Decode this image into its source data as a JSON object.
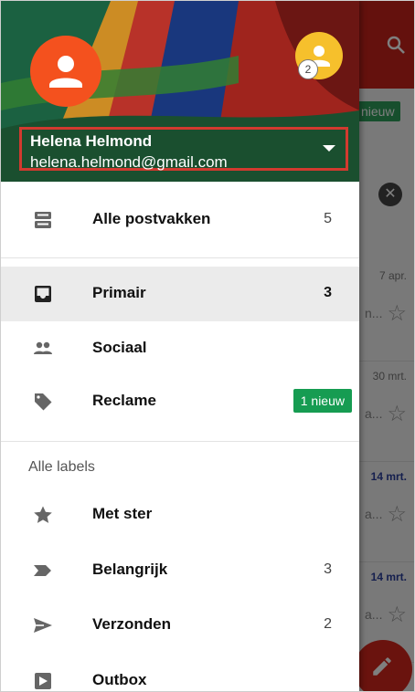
{
  "account": {
    "name": "Helena Helmond",
    "email": "helena.helmond@gmail.com",
    "secondary_badge": "2"
  },
  "background": {
    "chip": "nieuw",
    "dates": [
      "7 apr.",
      "30 mrt.",
      "14 mrt.",
      "14 mrt."
    ]
  },
  "drawer": {
    "all_inboxes": {
      "label": "Alle postvakken",
      "count": "5",
      "icon": "all-inboxes-icon"
    },
    "primary": {
      "label": "Primair",
      "count": "3",
      "icon": "inbox-icon"
    },
    "social": {
      "label": "Sociaal",
      "icon": "people-icon"
    },
    "promotions": {
      "label": "Reclame",
      "badge": "1 nieuw",
      "icon": "tag-icon"
    },
    "labels_heading": "Alle labels",
    "starred": {
      "label": "Met ster",
      "icon": "star-icon"
    },
    "important": {
      "label": "Belangrijk",
      "count": "3",
      "icon": "important-icon"
    },
    "sent": {
      "label": "Verzonden",
      "count": "2",
      "icon": "send-icon"
    },
    "outbox": {
      "label": "Outbox",
      "icon": "outbox-icon"
    }
  },
  "colors": {
    "toolbar": "#c9231a",
    "avatar_primary": "#f4511e",
    "avatar_secondary": "#f6c02c",
    "badge_green": "#169c52",
    "highlight_box": "#d23a2f"
  }
}
